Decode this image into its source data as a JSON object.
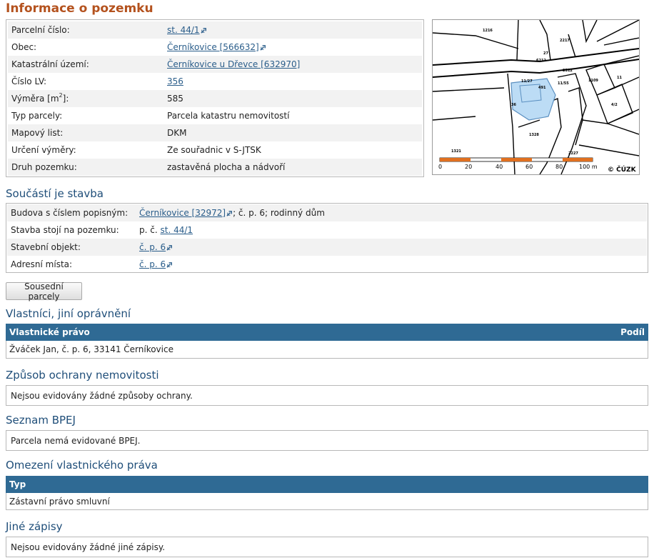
{
  "title": "Informace o pozemku",
  "parcel": {
    "rows": [
      {
        "label": "Parcelní číslo:",
        "value": "st. 44/1",
        "link": true,
        "ext": true
      },
      {
        "label": "Obec:",
        "value": "Černíkovice [566632]",
        "link": true,
        "ext": true
      },
      {
        "label": "Katastrální území:",
        "value": "Černíkovice u Dřevce [632970]",
        "link": true,
        "ext": false
      },
      {
        "label": "Číslo LV:",
        "value": "356",
        "link": true,
        "ext": false
      },
      {
        "label_pre": "Výměra [m",
        "label_sup": "2",
        "label_post": "]:",
        "value": "585",
        "link": false,
        "ext": false
      },
      {
        "label": "Typ parcely:",
        "value": "Parcela katastru nemovitostí",
        "link": false,
        "ext": false
      },
      {
        "label": "Mapový list:",
        "value": "DKM",
        "link": false,
        "ext": false
      },
      {
        "label": "Určení výměry:",
        "value": "Ze souřadnic v S-JTSK",
        "link": false,
        "ext": false
      },
      {
        "label": "Druh pozemku:",
        "value": "zastavěná plocha a nádvoří",
        "link": false,
        "ext": false
      }
    ]
  },
  "map": {
    "parcel_labels": [
      "1216",
      "27",
      "2217",
      "6212",
      "11/27",
      "36",
      "491",
      "11/55",
      "1109",
      "2312",
      "11",
      "1321",
      "1328",
      "2227",
      "4/2"
    ],
    "scale_ticks": [
      "0",
      "20",
      "40",
      "60",
      "80",
      "100 m"
    ],
    "copyright": "© ČÚZK",
    "highlight_color": "#bcdcf5"
  },
  "building": {
    "heading": "Součástí je stavba",
    "row1_label": "Budova s číslem popisným:",
    "row1_link": "Černíkovice [32972]",
    "row1_rest": "; č. p. 6; rodinný dům",
    "row2_label": "Stavba stojí na pozemku:",
    "row2_prefix": "p. č.",
    "row2_link": "st. 44/1",
    "row3_label": "Stavební objekt:",
    "row3_link": "č. p. 6",
    "row4_label": "Adresní místa:",
    "row4_link": "č. p. 6"
  },
  "neighbors_button": "Sousední parcely",
  "owners": {
    "heading": "Vlastníci, jiní oprávnění",
    "col1": "Vlastnické právo",
    "col2": "Podíl",
    "row": "Žváček Jan, č. p. 6, 33141 Černíkovice"
  },
  "protection": {
    "heading": "Způsob ochrany nemovitosti",
    "text": "Nejsou evidovány žádné způsoby ochrany."
  },
  "bpej": {
    "heading": "Seznam BPEJ",
    "text": "Parcela nemá evidované BPEJ."
  },
  "restrictions": {
    "heading": "Omezení vlastnického práva",
    "col1": "Typ",
    "row": "Zástavní právo smluvní"
  },
  "other": {
    "heading": "Jiné zápisy",
    "text": "Nejsou evidovány žádné jiné zápisy."
  },
  "colors": {
    "title": "#b4521e",
    "heading": "#1f4e79",
    "table_header": "#2f6a94",
    "link": "#2a5d8a"
  }
}
